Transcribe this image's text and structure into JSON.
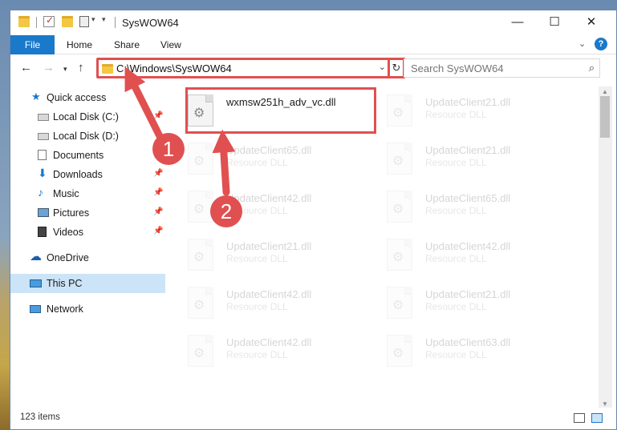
{
  "window": {
    "title": "SysWOW64",
    "controls": {
      "minimize": "—",
      "maximize": "☐",
      "close": "✕"
    }
  },
  "ribbon": {
    "tabs": [
      "File",
      "Home",
      "Share",
      "View"
    ],
    "help": "?"
  },
  "address": {
    "path": "C:\\Windows\\SysWOW64",
    "refresh_icon": "↻",
    "search_placeholder": "Search SysWOW64"
  },
  "sidebar": {
    "items": [
      {
        "label": "Quick access",
        "icon": "star-icon",
        "pinned": false
      },
      {
        "label": "Local Disk (C:)",
        "icon": "drive-icon",
        "pinned": true
      },
      {
        "label": "Local Disk (D:)",
        "icon": "drive-icon",
        "pinned": false
      },
      {
        "label": "Documents",
        "icon": "documents-icon",
        "pinned": true
      },
      {
        "label": "Downloads",
        "icon": "download-icon",
        "pinned": true
      },
      {
        "label": "Music",
        "icon": "music-icon",
        "pinned": true
      },
      {
        "label": "Pictures",
        "icon": "pictures-icon",
        "pinned": true
      },
      {
        "label": "Videos",
        "icon": "videos-icon",
        "pinned": true
      },
      {
        "label": "OneDrive",
        "icon": "cloud-icon",
        "pinned": false
      },
      {
        "label": "This PC",
        "icon": "computer-icon",
        "pinned": false,
        "active": true
      },
      {
        "label": "Network",
        "icon": "network-icon",
        "pinned": false
      }
    ]
  },
  "files": [
    {
      "name": "wxmsw251h_adv_vc.dll",
      "type": "",
      "highlighted": true
    },
    {
      "name": "UpdateClient21.dll",
      "type": "Resource DLL"
    },
    {
      "name": "UpdateClient65.dll",
      "type": "Resource DLL"
    },
    {
      "name": "UpdateClient21.dll",
      "type": "Resource DLL"
    },
    {
      "name": "UpdateClient42.dll",
      "type": "Resource DLL"
    },
    {
      "name": "UpdateClient65.dll",
      "type": "Resource DLL"
    },
    {
      "name": "UpdateClient21.dll",
      "type": "Resource DLL"
    },
    {
      "name": "UpdateClient42.dll",
      "type": "Resource DLL"
    },
    {
      "name": "UpdateClient42.dll",
      "type": "Resource DLL"
    },
    {
      "name": "UpdateClient21.dll",
      "type": "Resource DLL"
    },
    {
      "name": "UpdateClient42.dll",
      "type": "Resource DLL"
    },
    {
      "name": "UpdateClient63.dll",
      "type": "Resource DLL"
    }
  ],
  "status": {
    "item_count": "123 items"
  },
  "annotations": {
    "step1": "1",
    "step2": "2",
    "accent": "#e05050"
  }
}
